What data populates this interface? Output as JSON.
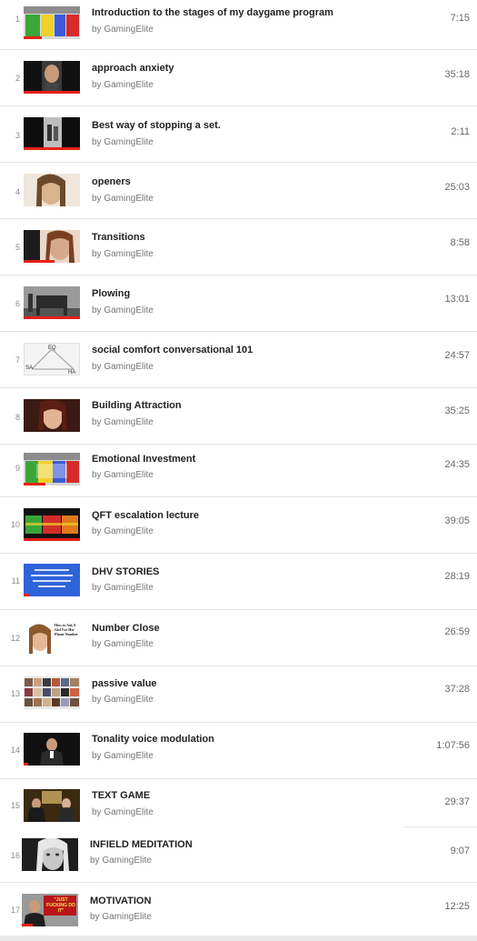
{
  "channel": "GamingElite",
  "items": [
    {
      "index": "1",
      "title": "Introduction to the stages of my daygame program",
      "by": "by GamingElite",
      "duration": "7:15"
    },
    {
      "index": "2",
      "title": "approach anxiety",
      "by": "by GamingElite",
      "duration": "35:18"
    },
    {
      "index": "3",
      "title": "Best way of stopping a set.",
      "by": "by GamingElite",
      "duration": "2:11"
    },
    {
      "index": "4",
      "title": "openers",
      "by": "by GamingElite",
      "duration": "25:03"
    },
    {
      "index": "5",
      "title": "Transitions",
      "by": "by GamingElite",
      "duration": "8:58"
    },
    {
      "index": "6",
      "title": "Plowing",
      "by": "by GamingElite",
      "duration": "13:01"
    },
    {
      "index": "7",
      "title": "social comfort conversational 101",
      "by": "by GamingElite",
      "duration": "24:57",
      "thumb_text": {
        "top": "EQ",
        "left": "SA",
        "right": "HA"
      }
    },
    {
      "index": "8",
      "title": "Building Attraction",
      "by": "by GamingElite",
      "duration": "35:25"
    },
    {
      "index": "9",
      "title": "Emotional Investment",
      "by": "by GamingElite",
      "duration": "24:35"
    },
    {
      "index": "10",
      "title": "QFT escalation lecture",
      "by": "by GamingElite",
      "duration": "39:05"
    },
    {
      "index": "11",
      "title": "DHV STORIES",
      "by": "by GamingElite",
      "duration": "28:19"
    },
    {
      "index": "12",
      "title": "Number Close",
      "by": "by GamingElite",
      "duration": "26:59",
      "thumb_text": {
        "caption": "How to Ask A Girl For Her Phone Number"
      }
    },
    {
      "index": "13",
      "title": "passive value",
      "by": "by GamingElite",
      "duration": "37:28"
    },
    {
      "index": "14",
      "title": "Tonality voice modulation",
      "by": "by GamingElite",
      "duration": "1:07:56"
    },
    {
      "index": "15",
      "title": "TEXT GAME",
      "by": "by GamingElite",
      "duration": "29:37"
    },
    {
      "index": "16",
      "title": "INFIELD MEDITATION",
      "by": "by GamingElite",
      "duration": "9:07"
    },
    {
      "index": "17",
      "title": "MOTIVATION",
      "by": "by GamingElite",
      "duration": "12:25",
      "thumb_text": {
        "caption": "\"JUST FUCKING DO IT\""
      }
    }
  ],
  "colors": {
    "progress": "#e62117",
    "separator": "#e4e4e4",
    "title": "#222222",
    "meta": "#767676"
  }
}
